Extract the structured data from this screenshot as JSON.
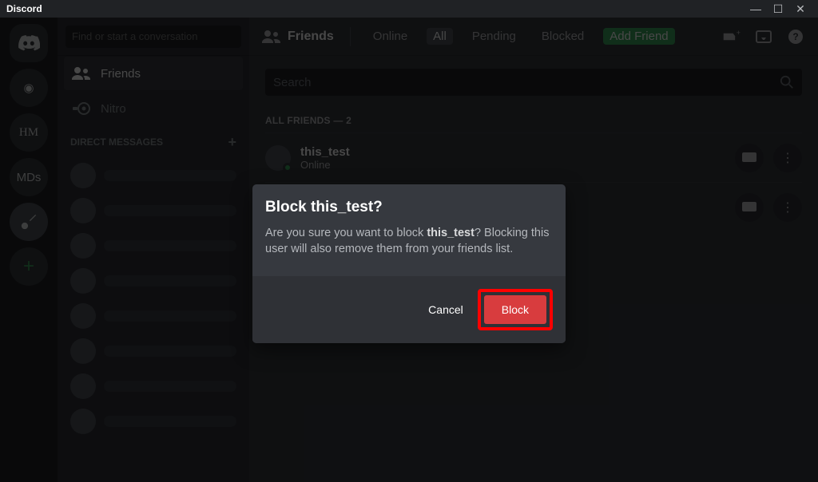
{
  "titlebar": {
    "title": "Discord"
  },
  "guilds": {
    "explore_label": "◉",
    "items": [
      "HM",
      "MDs"
    ]
  },
  "dm_col": {
    "search_placeholder": "Find or start a conversation",
    "friends_label": "Friends",
    "nitro_label": "Nitro",
    "dm_header": "DIRECT MESSAGES"
  },
  "topbar": {
    "friends_heading": "Friends",
    "tabs": {
      "online": "Online",
      "all": "All",
      "pending": "Pending",
      "blocked": "Blocked",
      "add_friend": "Add Friend"
    }
  },
  "search": {
    "placeholder": "Search"
  },
  "friends": {
    "section_label": "ALL FRIENDS — 2",
    "items": [
      {
        "name": "this_test",
        "status": "Online"
      },
      {
        "name": "",
        "status": ""
      }
    ]
  },
  "modal": {
    "title": "Block this_test?",
    "text_pre": "Are you sure you want to block ",
    "username": "this_test",
    "text_post": "? Blocking this user will also remove them from your friends list.",
    "cancel": "Cancel",
    "block": "Block"
  }
}
